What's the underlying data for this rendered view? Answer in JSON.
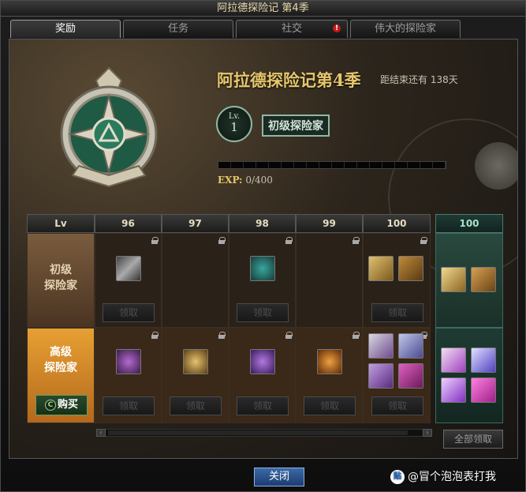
{
  "window": {
    "title": "阿拉德探险记 第4季"
  },
  "tabs": [
    {
      "label": "奖励",
      "active": true
    },
    {
      "label": "任务",
      "active": false
    },
    {
      "label": "社交",
      "active": false,
      "alert": "!"
    },
    {
      "label": "伟大的探险家",
      "active": false
    }
  ],
  "season": {
    "title": "阿拉德探险记第4季",
    "days_left": "距结束还有 138天"
  },
  "level": {
    "label": "Lv.",
    "value": "1",
    "rank": "初级探险家"
  },
  "exp": {
    "label": "EXP:",
    "value_text": "0/400",
    "current": 0,
    "max": 400
  },
  "grid": {
    "corner_header": "Lv",
    "level_headers": [
      "96",
      "97",
      "98",
      "99",
      "100"
    ],
    "final_header": "100",
    "tiers": {
      "normal": {
        "line1": "初级",
        "line2": "探险家"
      },
      "advanced": {
        "line1": "高级",
        "line2": "探险家",
        "buy_label": "购买",
        "buy_icon": "coin-icon"
      }
    },
    "claim_label": "领取"
  },
  "colors": {
    "accent_gold": "#e7c76c",
    "final_column": "#1e3b33",
    "advanced_tier": "#e7a033",
    "close_button": "#3b6aa8"
  },
  "claim_all_label": "全部领取",
  "close_label": "关闭",
  "watermark": {
    "icon": "贴",
    "text": "@冒个泡泡表打我"
  }
}
